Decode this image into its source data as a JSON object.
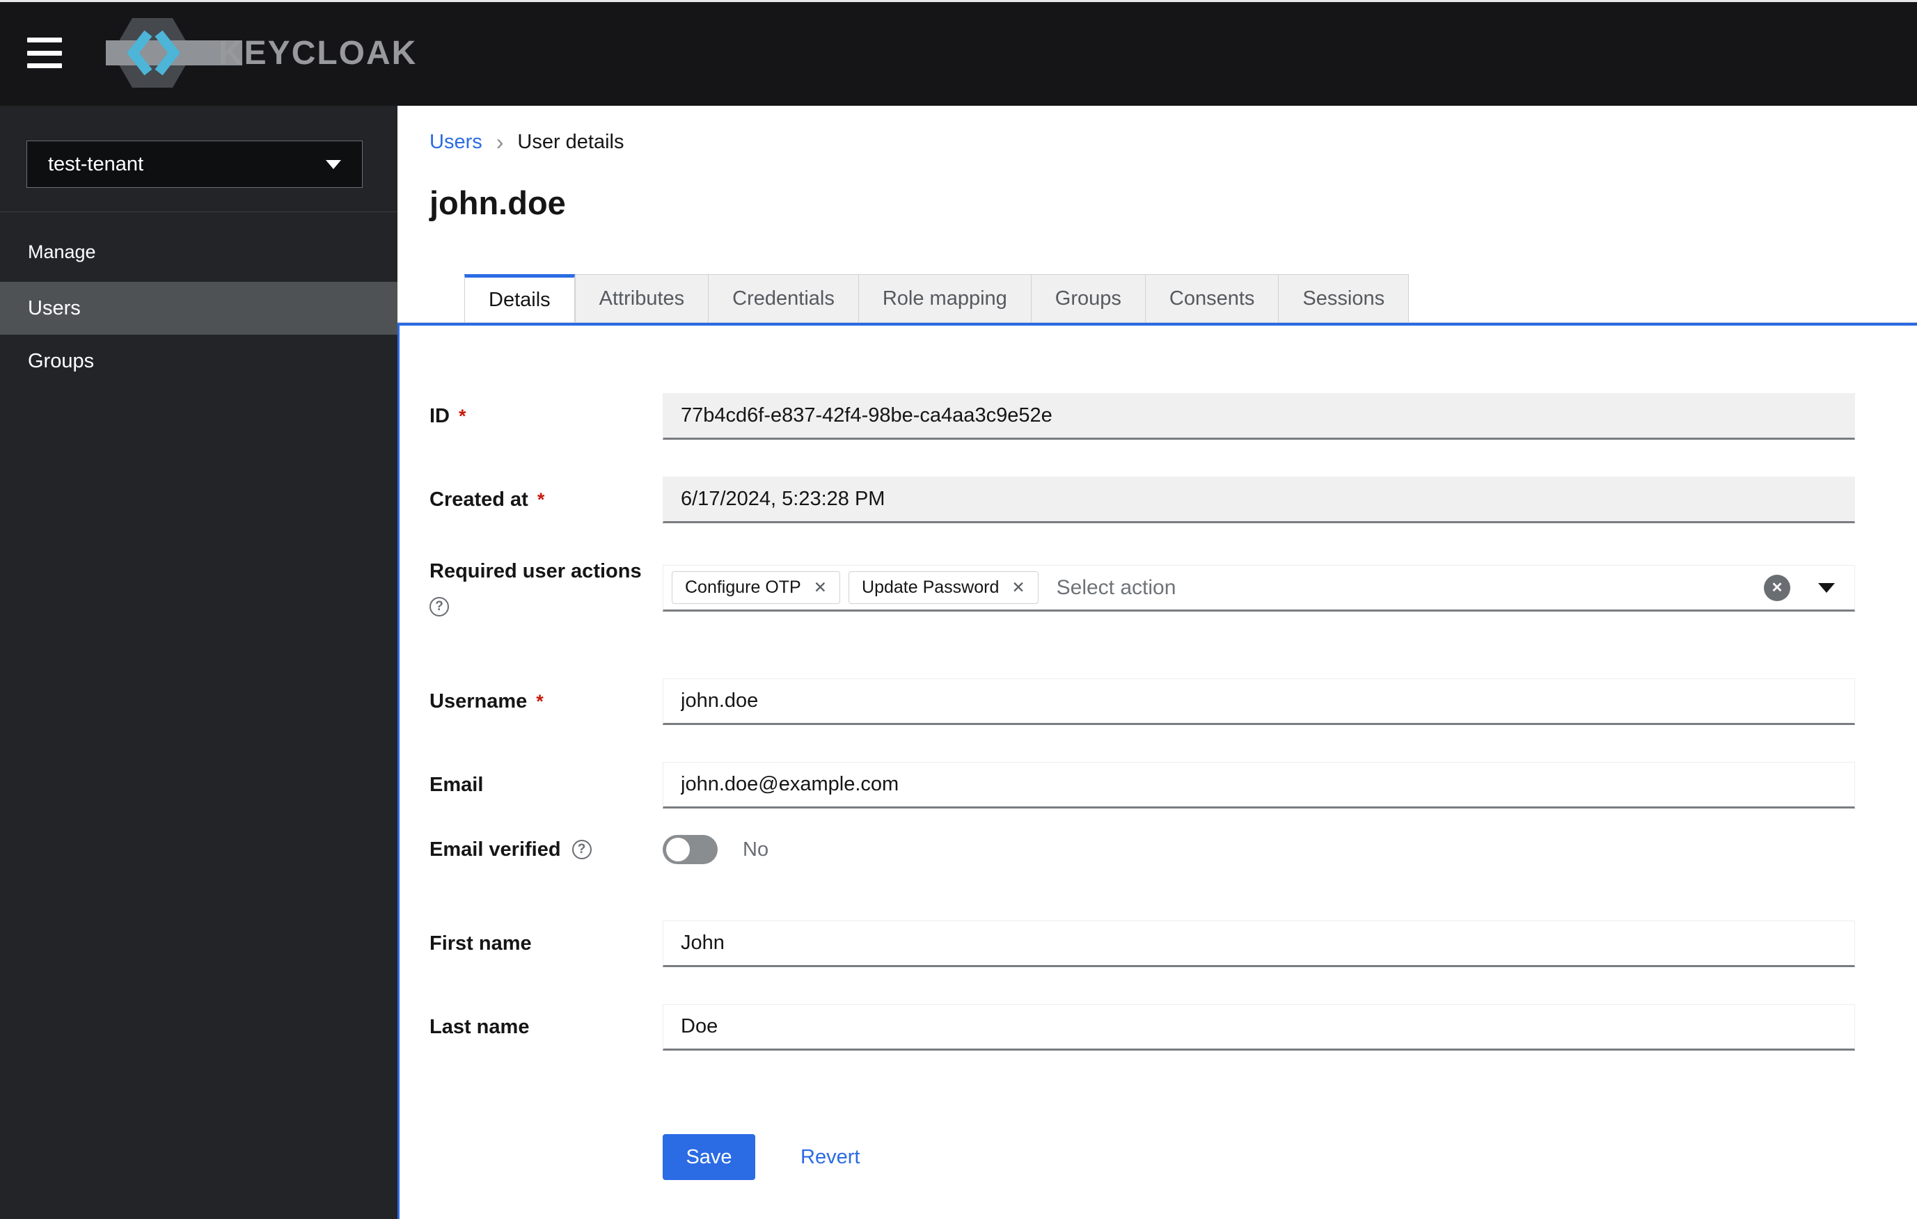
{
  "ui": {
    "required_marker": "*",
    "breadcrumb_separator": "›",
    "help_glyph": "?",
    "chip_close_glyph": "✕",
    "clear_glyph": "✕"
  },
  "colors": {
    "accent": "#2b6be4",
    "danger": "#c9190b",
    "sidebar_bg": "#222428",
    "masthead_bg": "#151517",
    "nav_active_bg": "#4f5255"
  },
  "masthead": {
    "brand": "KEYCLOAK"
  },
  "sidebar": {
    "realm": "test-tenant",
    "section": "Manage",
    "items": {
      "users": "Users",
      "groups": "Groups"
    }
  },
  "breadcrumb": {
    "parent": "Users",
    "current": "User details"
  },
  "page": {
    "title": "john.doe"
  },
  "tabs": {
    "details": "Details",
    "attributes": "Attributes",
    "credentials": "Credentials",
    "role_mapping": "Role mapping",
    "groups": "Groups",
    "consents": "Consents",
    "sessions": "Sessions"
  },
  "form": {
    "id": {
      "label": "ID",
      "value": "77b4cd6f-e837-42f4-98be-ca4aa3c9e52e"
    },
    "created_at": {
      "label": "Created at",
      "value": "6/17/2024, 5:23:28 PM"
    },
    "required_user_actions": {
      "label": "Required user actions",
      "chips": [
        "Configure OTP",
        "Update Password"
      ],
      "placeholder": "Select action"
    },
    "username": {
      "label": "Username",
      "value": "john.doe"
    },
    "email": {
      "label": "Email",
      "value": "john.doe@example.com"
    },
    "email_verified": {
      "label": "Email verified",
      "state": "No"
    },
    "first_name": {
      "label": "First name",
      "value": "John"
    },
    "last_name": {
      "label": "Last name",
      "value": "Doe"
    }
  },
  "actions": {
    "save": "Save",
    "revert": "Revert"
  }
}
